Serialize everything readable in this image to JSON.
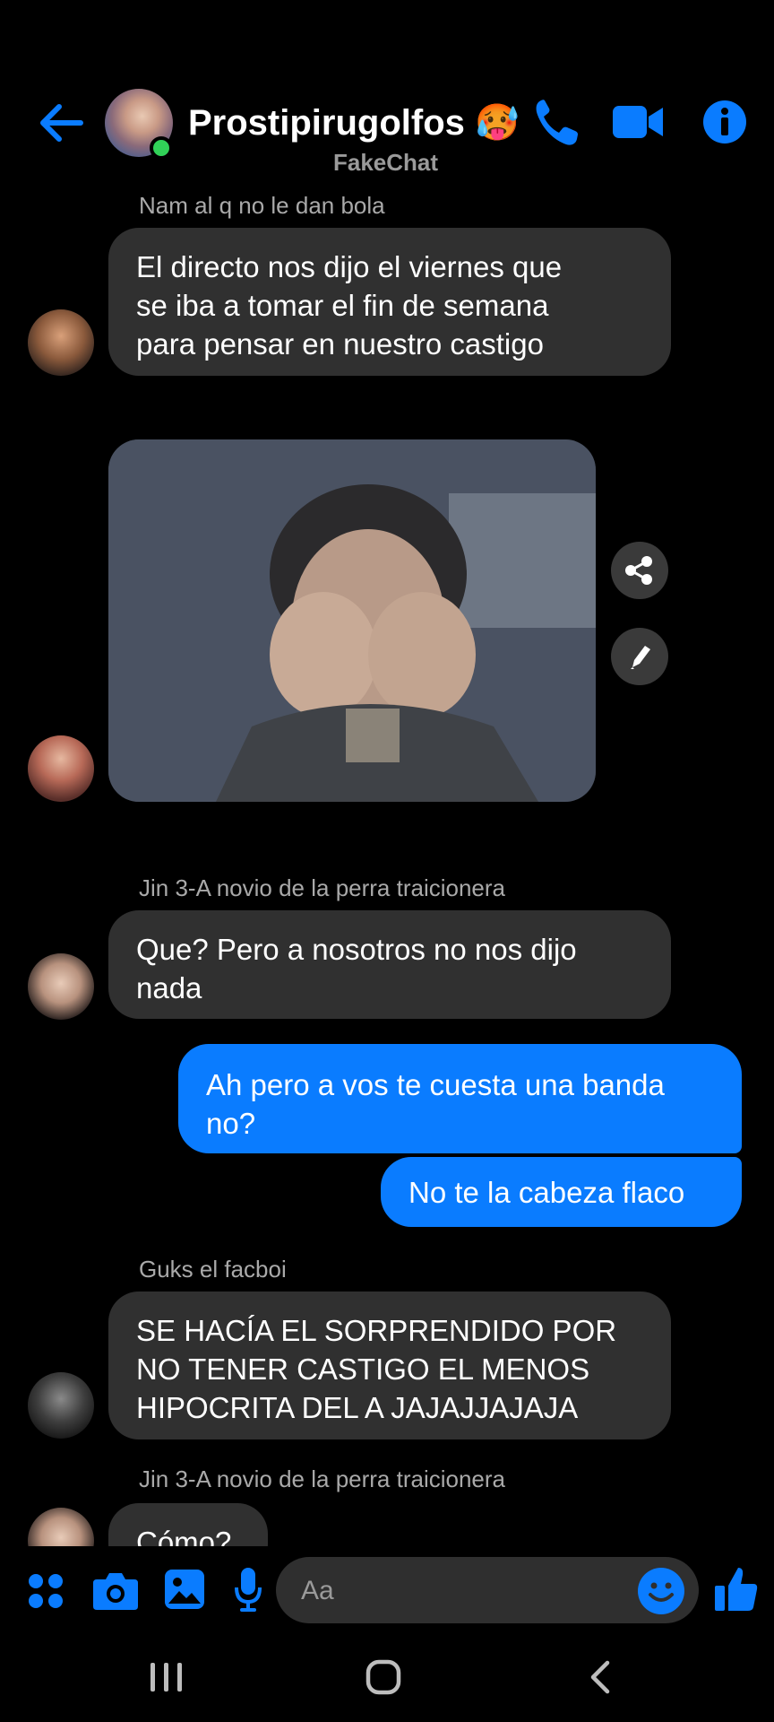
{
  "header": {
    "title": "Prostipirugolfos 🥵",
    "subtitle": "FakeChat"
  },
  "messages": [
    {
      "sender": "Nam al q no le dan bola",
      "lines": [
        "El directo nos dijo el viernes que",
        "se iba a tomar el fin de semana",
        "para pensar en nuestro castigo"
      ]
    },
    {
      "sender": "Jin 3-A novio de la perra traicionera",
      "lines": [
        "Que? Pero a nosotros no nos dijo",
        "nada"
      ]
    },
    {
      "outgoing": true,
      "lines": [
        "Ah pero a vos te cuesta una banda",
        "no?"
      ]
    },
    {
      "outgoing": true,
      "lines": [
        "No te la cabeza flaco"
      ]
    },
    {
      "sender": "Guks el facboi",
      "lines": [
        "SE HACÍA EL SORPRENDIDO POR",
        "NO TENER CASTIGO EL MENOS",
        "HIPOCRITA DEL A JAJAJJAJAJA"
      ]
    },
    {
      "sender": "Jin 3-A novio de la perra traicionera",
      "lines": [
        "Cómo?"
      ]
    }
  ],
  "composer": {
    "placeholder": "Aa"
  },
  "colors": {
    "accent": "#0a7cff",
    "incoming_bubble": "#303030",
    "background": "#000000",
    "online": "#31d158"
  },
  "icons": [
    "back-arrow-icon",
    "phone-icon",
    "video-camera-icon",
    "info-icon",
    "share-icon",
    "pencil-icon",
    "apps-grid-icon",
    "camera-icon",
    "gallery-icon",
    "microphone-icon",
    "emoji-icon",
    "thumbs-up-icon",
    "recent-apps-icon",
    "home-icon",
    "nav-back-icon"
  ]
}
